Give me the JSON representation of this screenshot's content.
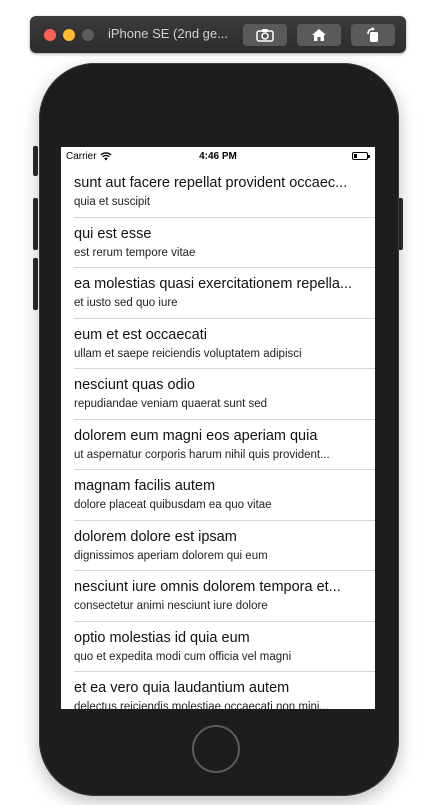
{
  "window": {
    "title": "iPhone SE (2nd ge...",
    "buttons": [
      {
        "icon": "screenshot-icon"
      },
      {
        "icon": "home-icon"
      },
      {
        "icon": "rotate-icon"
      }
    ]
  },
  "status_bar": {
    "carrier": "Carrier",
    "time": "4:46 PM"
  },
  "list": {
    "items": [
      {
        "title": "sunt aut facere repellat provident occaec...",
        "subtitle": "quia et suscipit"
      },
      {
        "title": "qui est esse",
        "subtitle": "est rerum tempore vitae"
      },
      {
        "title": "ea molestias quasi exercitationem repella...",
        "subtitle": "et iusto sed quo iure"
      },
      {
        "title": "eum et est occaecati",
        "subtitle": "ullam et saepe reiciendis voluptatem adipisci"
      },
      {
        "title": "nesciunt quas odio",
        "subtitle": "repudiandae veniam quaerat sunt sed"
      },
      {
        "title": "dolorem eum magni eos aperiam quia",
        "subtitle": "ut aspernatur corporis harum nihil quis provident..."
      },
      {
        "title": "magnam facilis autem",
        "subtitle": "dolore placeat quibusdam ea quo vitae"
      },
      {
        "title": "dolorem dolore est ipsam",
        "subtitle": "dignissimos aperiam dolorem qui eum"
      },
      {
        "title": "nesciunt iure omnis dolorem tempora et...",
        "subtitle": "consectetur animi nesciunt iure dolore"
      },
      {
        "title": "optio molestias id quia eum",
        "subtitle": "quo et expedita modi cum officia vel magni"
      },
      {
        "title": "et ea vero quia laudantium autem",
        "subtitle": "delectus reiciendis molestiae occaecati non mini..."
      }
    ]
  }
}
